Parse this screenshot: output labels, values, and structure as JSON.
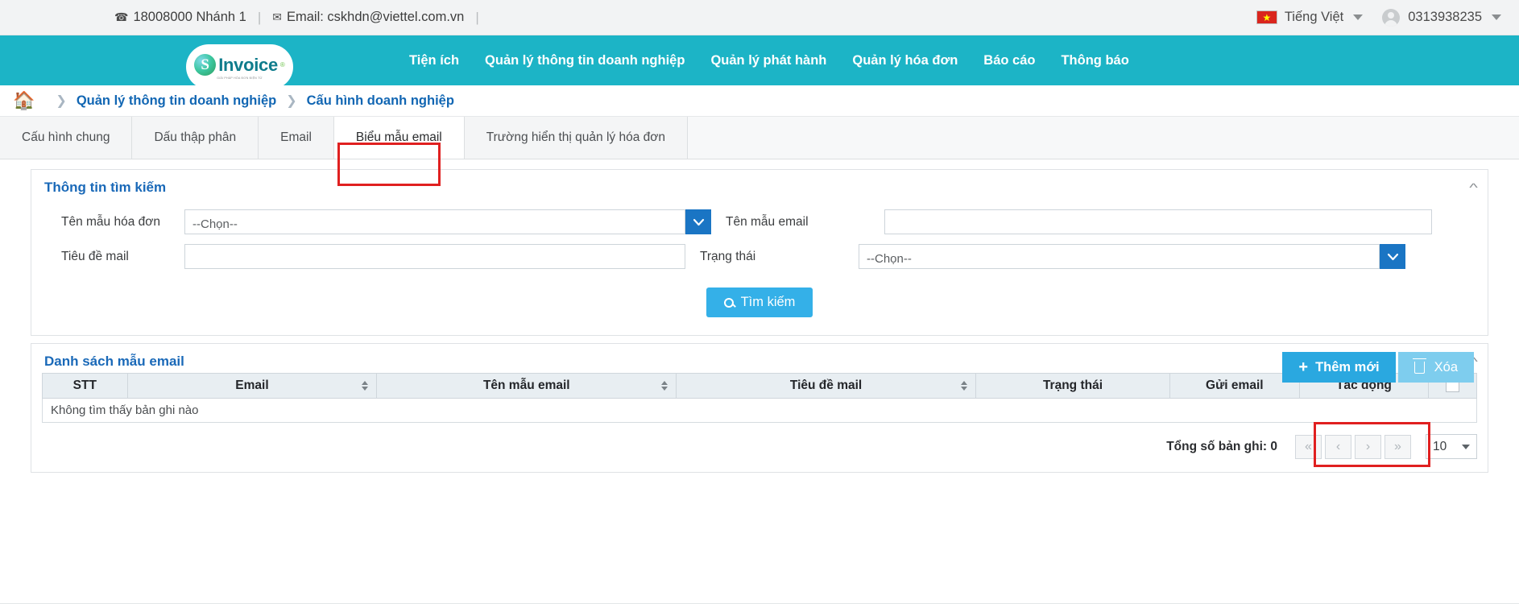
{
  "topbar": {
    "phone_icon": "phone-icon",
    "phone": "18008000 Nhánh 1",
    "email_icon": "envelope-icon",
    "email": "Email: cskhdn@viettel.com.vn",
    "separator": "|",
    "language": "Tiếng Việt",
    "account": "0313938235"
  },
  "brand": {
    "logo_letter": "S",
    "logo_word": "Invoice",
    "logo_tm": "®",
    "logo_sub": "GIẢI PHÁP HÓA ĐƠN ĐIỆN TỬ"
  },
  "nav": {
    "items": [
      {
        "label": "Tiện ích"
      },
      {
        "label": "Quản lý thông tin doanh nghiệp"
      },
      {
        "label": "Quản lý phát hành"
      },
      {
        "label": "Quản lý hóa đơn"
      },
      {
        "label": "Báo cáo"
      },
      {
        "label": "Thông báo"
      }
    ]
  },
  "breadcrumb": {
    "home_icon": "home-icon",
    "sep": "❯",
    "items": [
      {
        "label": "Quản lý thông tin doanh nghiệp"
      },
      {
        "label": "Cấu hình doanh nghiệp"
      }
    ]
  },
  "tabs": [
    {
      "label": "Cấu hình chung",
      "active": false
    },
    {
      "label": "Dấu thập phân",
      "active": false
    },
    {
      "label": "Email",
      "active": false
    },
    {
      "label": "Biểu mẫu email",
      "active": true
    },
    {
      "label": "Trường hiển thị quản lý hóa đơn",
      "active": false
    }
  ],
  "search_panel": {
    "title": "Thông tin tìm kiếm",
    "collapse_icon": "chevron-up-icon",
    "fields": {
      "invoice_template_label": "Tên mẫu hóa đơn",
      "invoice_template_value": "--Chọn--",
      "email_template_label": "Tên mẫu email",
      "email_template_value": "",
      "email_template_placeholder": "",
      "mail_subject_label": "Tiêu đề mail",
      "mail_subject_value": "",
      "mail_subject_placeholder": "",
      "status_label": "Trạng thái",
      "status_value": "--Chọn--"
    },
    "search_button": "Tìm kiếm",
    "search_icon": "search-icon"
  },
  "list_panel": {
    "title": "Danh sách mẫu email",
    "collapse_icon": "chevron-up-icon",
    "add_button": "Thêm mới",
    "add_icon": "plus-icon",
    "delete_button": "Xóa",
    "delete_icon": "trash-icon",
    "columns": [
      {
        "label": "STT",
        "sortable": false
      },
      {
        "label": "Email",
        "sortable": true
      },
      {
        "label": "Tên mẫu email",
        "sortable": true
      },
      {
        "label": "Tiêu đề mail",
        "sortable": true
      },
      {
        "label": "Trạng thái",
        "sortable": false
      },
      {
        "label": "Gửi email",
        "sortable": false
      },
      {
        "label": "Tác động",
        "sortable": false
      }
    ],
    "rows": [],
    "empty_message": "Không tìm thấy bản ghi nào",
    "total_records": "Tổng số bản ghi: 0",
    "pagination": {
      "first": "«",
      "prev": "‹",
      "next": "›",
      "last": "»",
      "page_size": "10"
    }
  },
  "colors": {
    "teal": "#1cb4c6",
    "blue_link": "#1166b3",
    "accent_blue": "#2aa8e0",
    "highlight_red": "#e02020",
    "select_blue": "#1a75c4"
  }
}
